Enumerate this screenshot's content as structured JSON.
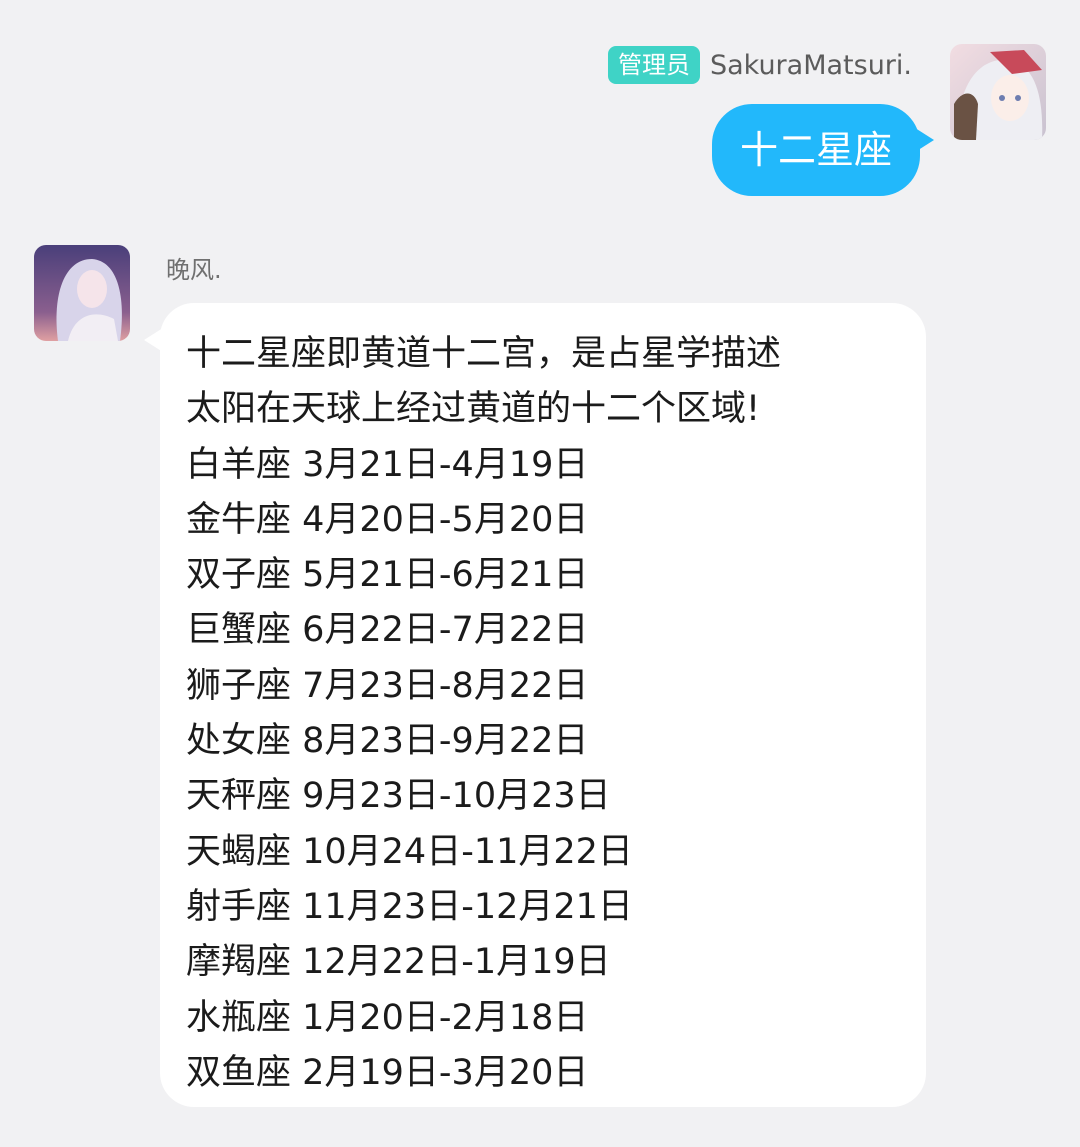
{
  "outgoing": {
    "role_badge": "管理员",
    "sender_name": "SakuraMatsuri.",
    "message": "十二星座"
  },
  "incoming": {
    "sender_name": "晚风.",
    "lines": [
      "十二星座即黄道十二宫，是占星学描述",
      "太阳在天球上经过黄道的十二个区域!",
      "白羊座 3月21日-4月19日",
      "金牛座 4月20日-5月20日",
      "双子座 5月21日-6月21日",
      "巨蟹座 6月22日-7月22日",
      "狮子座 7月23日-8月22日",
      "处女座 8月23日-9月22日",
      "天秤座 9月23日-10月23日",
      "天蝎座 10月24日-11月22日",
      "射手座 11月23日-12月21日",
      "摩羯座 12月22日-1月19日",
      "水瓶座 1月20日-2月18日",
      "双鱼座 2月19日-3月20日"
    ]
  },
  "colors": {
    "background": "#f1f1f3",
    "outgoing_bubble": "#22b8fb",
    "role_badge": "#3fd3c6",
    "incoming_bubble": "#ffffff"
  }
}
